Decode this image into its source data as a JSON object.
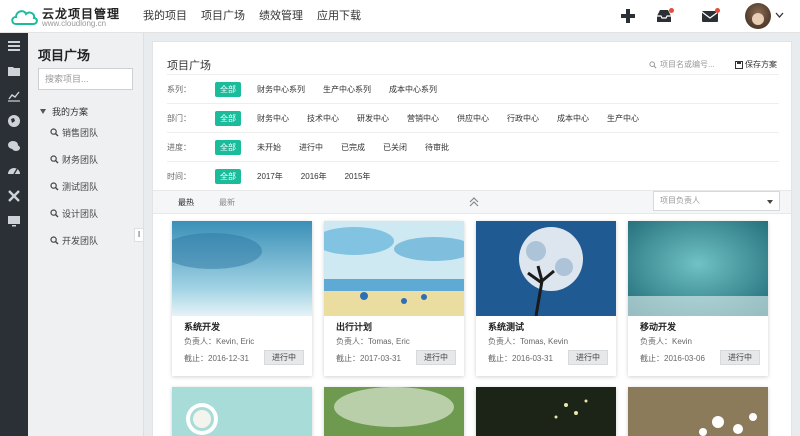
{
  "app": {
    "title": "云龙项目管理",
    "subtitle": "www.cloudlong.cn"
  },
  "nav": {
    "items": [
      "我的项目",
      "项目广场",
      "绩效管理",
      "应用下载"
    ]
  },
  "sidebar": {
    "title": "项目广场",
    "search_placeholder": "搜索项目...",
    "group": "我的方案",
    "items": [
      "销售团队",
      "财务团队",
      "测试团队",
      "设计团队",
      "开发团队"
    ],
    "collapse_label": "ǀ"
  },
  "panel": {
    "title": "项目广场",
    "search_placeholder": "项目名或编号...",
    "save_label": "保存方案",
    "filters": [
      {
        "label": "系列：",
        "tags": [
          "全部",
          "财务中心系列",
          "生产中心系列",
          "成本中心系列"
        ]
      },
      {
        "label": "部门：",
        "tags": [
          "全部",
          "财务中心",
          "技术中心",
          "研发中心",
          "营销中心",
          "供应中心",
          "行政中心",
          "成本中心",
          "生产中心"
        ]
      },
      {
        "label": "进度：",
        "tags": [
          "全部",
          "未开始",
          "进行中",
          "已完成",
          "已关闭",
          "待审批"
        ]
      },
      {
        "label": "时间：",
        "tags": [
          "全部",
          "2017年",
          "2016年",
          "2015年"
        ]
      }
    ],
    "sort": {
      "hot": "最热",
      "new": "最新"
    },
    "owner_placeholder": "项目负责人"
  },
  "cards": [
    {
      "name": "系统开发",
      "owner": "负责人：Kevin, Eric",
      "date": "截止：2016-12-31",
      "status": "进行中"
    },
    {
      "name": "出行计划",
      "owner": "负责人：Tomas, Eric",
      "date": "截止：2017-03-31",
      "status": "进行中"
    },
    {
      "name": "系统测试",
      "owner": "负责人：Tomas, Kevin",
      "date": "截止：2016-03-31",
      "status": "进行中"
    },
    {
      "name": "移动开发",
      "owner": "负责人：Kevin",
      "date": "截止：2016-03-06",
      "status": "进行中"
    }
  ],
  "colors": {
    "accent": "#1abc9c",
    "rail": "#2b3036",
    "notify": "#e74c3c"
  }
}
